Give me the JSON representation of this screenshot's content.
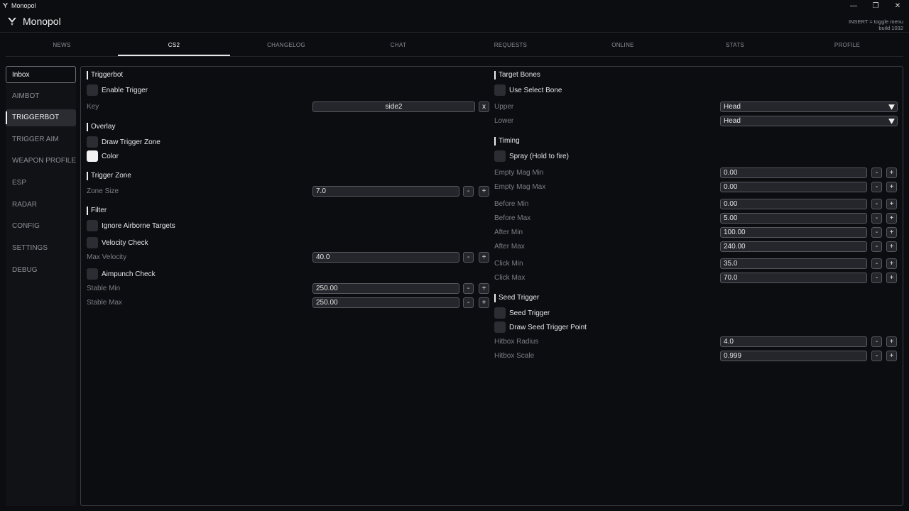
{
  "window": {
    "title": "Monopol",
    "minimize": "—",
    "maximize": "❐",
    "close": "✕"
  },
  "header": {
    "brand": "Monopol",
    "hint_line1": "INSERT = toggle menu",
    "hint_line2": "build 1032"
  },
  "tabs": [
    "NEWS",
    "CS2",
    "CHANGELOG",
    "CHAT",
    "REQUESTS",
    "ONLINE",
    "STATS",
    "PROFILE"
  ],
  "active_tab": "CS2",
  "sidebar": {
    "inbox": "Inbox",
    "items": [
      "AIMBOT",
      "TRIGGERBOT",
      "TRIGGER AIM",
      "WEAPON PROFILES",
      "ESP",
      "RADAR",
      "CONFIG",
      "SETTINGS",
      "DEBUG"
    ],
    "active": "TRIGGERBOT"
  },
  "left": {
    "triggerbot": {
      "title": "Triggerbot",
      "enable_trigger": "Enable Trigger",
      "key_label": "Key",
      "key_value": "side2",
      "key_clear": "x"
    },
    "overlay": {
      "title": "Overlay",
      "draw_trigger_zone": "Draw Trigger Zone",
      "color": "Color"
    },
    "trigger_zone": {
      "title": "Trigger Zone",
      "zone_size_label": "Zone Size",
      "zone_size_value": "7.0"
    },
    "filter": {
      "title": "Filter",
      "ignore_airborne": "Ignore Airborne Targets",
      "velocity_check": "Velocity Check",
      "max_velocity_label": "Max Velocity",
      "max_velocity_value": "40.0",
      "aimpunch_check": "Aimpunch Check",
      "stable_min_label": "Stable Min",
      "stable_min_value": "250.00",
      "stable_max_label": "Stable Max",
      "stable_max_value": "250.00"
    }
  },
  "right": {
    "target_bones": {
      "title": "Target Bones",
      "use_select_bone": "Use Select Bone",
      "upper_label": "Upper",
      "upper_value": "Head",
      "lower_label": "Lower",
      "lower_value": "Head"
    },
    "timing": {
      "title": "Timing",
      "spray": "Spray (Hold to fire)",
      "empty_mag_min_label": "Empty Mag Min",
      "empty_mag_min_value": "0.00",
      "empty_mag_max_label": "Empty Mag Max",
      "empty_mag_max_value": "0.00",
      "before_min_label": "Before Min",
      "before_min_value": "0.00",
      "before_max_label": "Before Max",
      "before_max_value": "5.00",
      "after_min_label": "After Min",
      "after_min_value": "100.00",
      "after_max_label": "After Max",
      "after_max_value": "240.00",
      "click_min_label": "Click Min",
      "click_min_value": "35.0",
      "click_max_label": "Click Max",
      "click_max_value": "70.0"
    },
    "seed_trigger": {
      "title": "Seed Trigger",
      "seed_trigger": "Seed Trigger",
      "draw_seed_trigger_point": "Draw Seed Trigger Point",
      "hitbox_radius_label": "Hitbox Radius",
      "hitbox_radius_value": "4.0",
      "hitbox_scale_label": "Hitbox Scale",
      "hitbox_scale_value": "0.999"
    }
  },
  "stepper": {
    "minus": "-",
    "plus": "+"
  }
}
